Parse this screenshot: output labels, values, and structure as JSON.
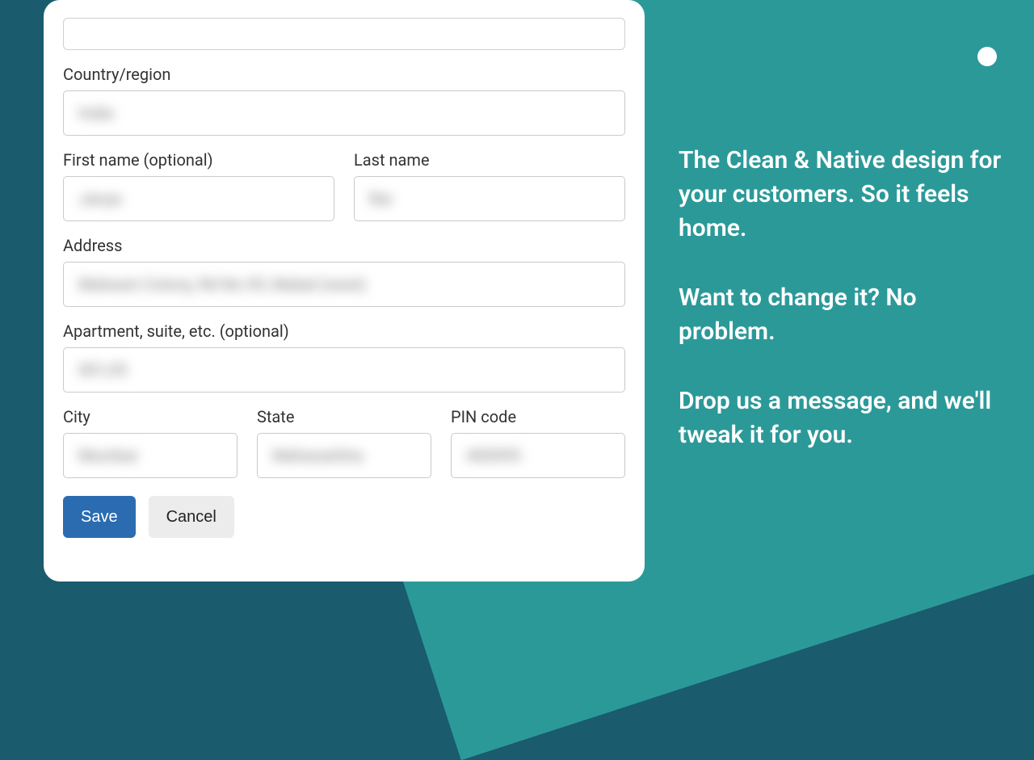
{
  "form": {
    "country_label": "Country/region",
    "country_value": "India",
    "first_name_label": "First name (optional)",
    "first_name_value": "Janya",
    "last_name_label": "Last name",
    "last_name_value": "Rai",
    "address_label": "Address",
    "address_value": "Malwani Colony, Rd No 05, Malad (west)",
    "apartment_label": "Apartment, suite, etc. (optional)",
    "apartment_value": "001,05",
    "city_label": "City",
    "city_value": "Mumbai",
    "state_label": "State",
    "state_value": "Maharashtra",
    "pin_label": "PIN code",
    "pin_value": "400095",
    "save_label": "Save",
    "cancel_label": "Cancel"
  },
  "promo": {
    "p1": "The Clean & Native design for your customers. So it feels home.",
    "p2": "Want to change it? No problem.",
    "p3": "Drop us a message, and we'll tweak it for you."
  }
}
